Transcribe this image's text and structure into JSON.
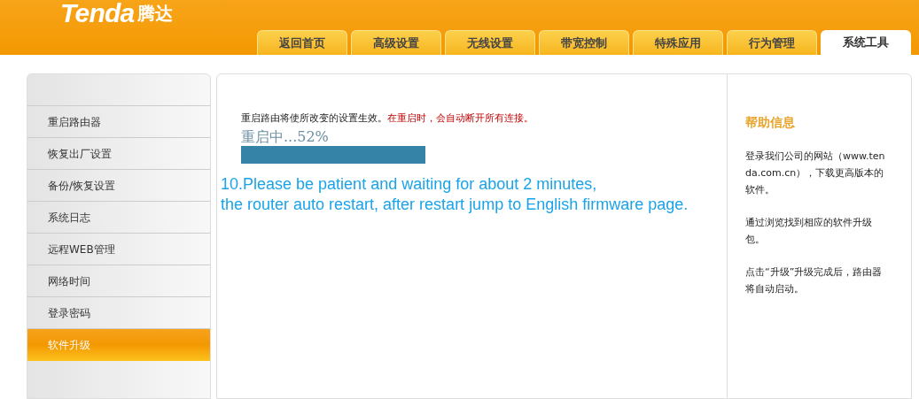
{
  "header": {
    "logo": "Tenda",
    "logo_suffix": "腾达"
  },
  "tabs": [
    {
      "label": "返回首页",
      "selected": false
    },
    {
      "label": "高级设置",
      "selected": false
    },
    {
      "label": "无线设置",
      "selected": false
    },
    {
      "label": "带宽控制",
      "selected": false
    },
    {
      "label": "特殊应用",
      "selected": false
    },
    {
      "label": "行为管理",
      "selected": false
    },
    {
      "label": "系统工具",
      "selected": true
    }
  ],
  "sidebar": {
    "items": [
      {
        "label": "重启路由器",
        "selected": false
      },
      {
        "label": "恢复出厂设置",
        "selected": false
      },
      {
        "label": "备份/恢复设置",
        "selected": false
      },
      {
        "label": "系统日志",
        "selected": false
      },
      {
        "label": "远程WEB管理",
        "selected": false
      },
      {
        "label": "网络时间",
        "selected": false
      },
      {
        "label": "登录密码",
        "selected": false
      },
      {
        "label": "软件升级",
        "selected": true
      }
    ]
  },
  "main": {
    "notice": "重启路由将使所改变的设置生效。",
    "warning": "在重启时，会自动断开所有连接。",
    "progress_text": "重启中...52%",
    "annotation": [
      "10.Please be patient and waiting for about 2 minutes,",
      "the router auto restart, after restart jump to English firmware page."
    ]
  },
  "help": {
    "title": "帮助信息",
    "paragraphs": [
      "登录我们公司的网站（www.tenda.com.cn），下载更高版本的软件。",
      "通过浏览找到相应的软件升级包。",
      "点击“升级”升级完成后，路由器将自动启动。"
    ]
  }
}
